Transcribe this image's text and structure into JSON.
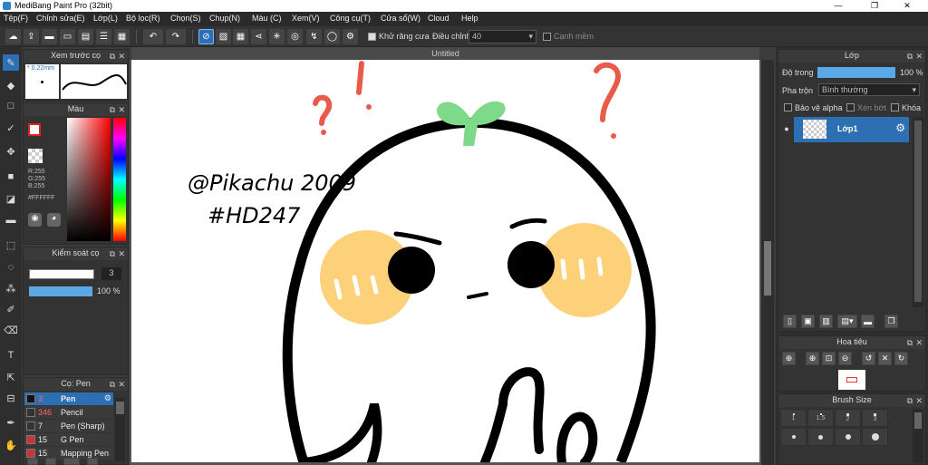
{
  "window": {
    "title": "MediBang Paint Pro (32bit)",
    "minimize": "—",
    "restore": "❐",
    "close": "✕"
  },
  "menu": [
    "Tệp(F)",
    "Chỉnh sửa(E)",
    "Lớp(L)",
    "Bộ lọc(R)",
    "Chọn(S)",
    "Chụp(N)",
    "Màu (C)",
    "Xem(V)",
    "Công cụ(T)",
    "Cửa sổ(W)",
    "Cloud",
    "Help"
  ],
  "toolbar": {
    "antialias_label": "Khử răng cưa",
    "correction_label": "Điều chỉnh",
    "correction_value": "40",
    "soft_edge_label": "Cạnh mềm"
  },
  "canvas": {
    "tab_title": "Untitled",
    "text_line1": "@Pikachu 2009",
    "text_line2": "#HD247"
  },
  "panels": {
    "brush_preview": {
      "title": "Xem trước cọ",
      "size": "0.22mm"
    },
    "color": {
      "title": "Màu",
      "r": "R:255",
      "g": "G:255",
      "b": "B:255",
      "hex": "#FFFFFF"
    },
    "brush_control": {
      "title": "Kiểm soát cọ",
      "size_value": "3",
      "opacity_value": "100 %"
    },
    "brush_list": {
      "title": "Cọ: Pen",
      "items": [
        {
          "num": "3",
          "name": "Pen",
          "color": "#111111",
          "selected": true
        },
        {
          "num": "346",
          "name": "Pencil",
          "color": "#333333",
          "selected": false
        },
        {
          "num": "7",
          "name": "Pen (Sharp)",
          "color": "#333333",
          "selected": false
        },
        {
          "num": "15",
          "name": "G Pen",
          "color": "#cc3333",
          "selected": false
        },
        {
          "num": "15",
          "name": "Mapping Pen",
          "color": "#cc3333",
          "selected": false
        }
      ]
    },
    "layer": {
      "title": "Lớp",
      "opacity_label": "Độ trong",
      "opacity_value": "100 %",
      "blend_label": "Pha trộn",
      "blend_value": "Bình thường",
      "protect_alpha": "Bảo vệ alpha",
      "clipping": "Xén bớt",
      "lock": "Khóa",
      "layer_name": "Lớp1"
    },
    "navigator": {
      "title": "Hoa tiêu"
    },
    "brush_size": {
      "title": "Brush Size",
      "sizes": [
        "1",
        "1.5",
        "2",
        "3"
      ]
    }
  },
  "colors": {
    "accent": "#2d6fb3",
    "sprout": "#7fd98a",
    "cheek": "#fcd17a",
    "question": "#e85a4a"
  }
}
